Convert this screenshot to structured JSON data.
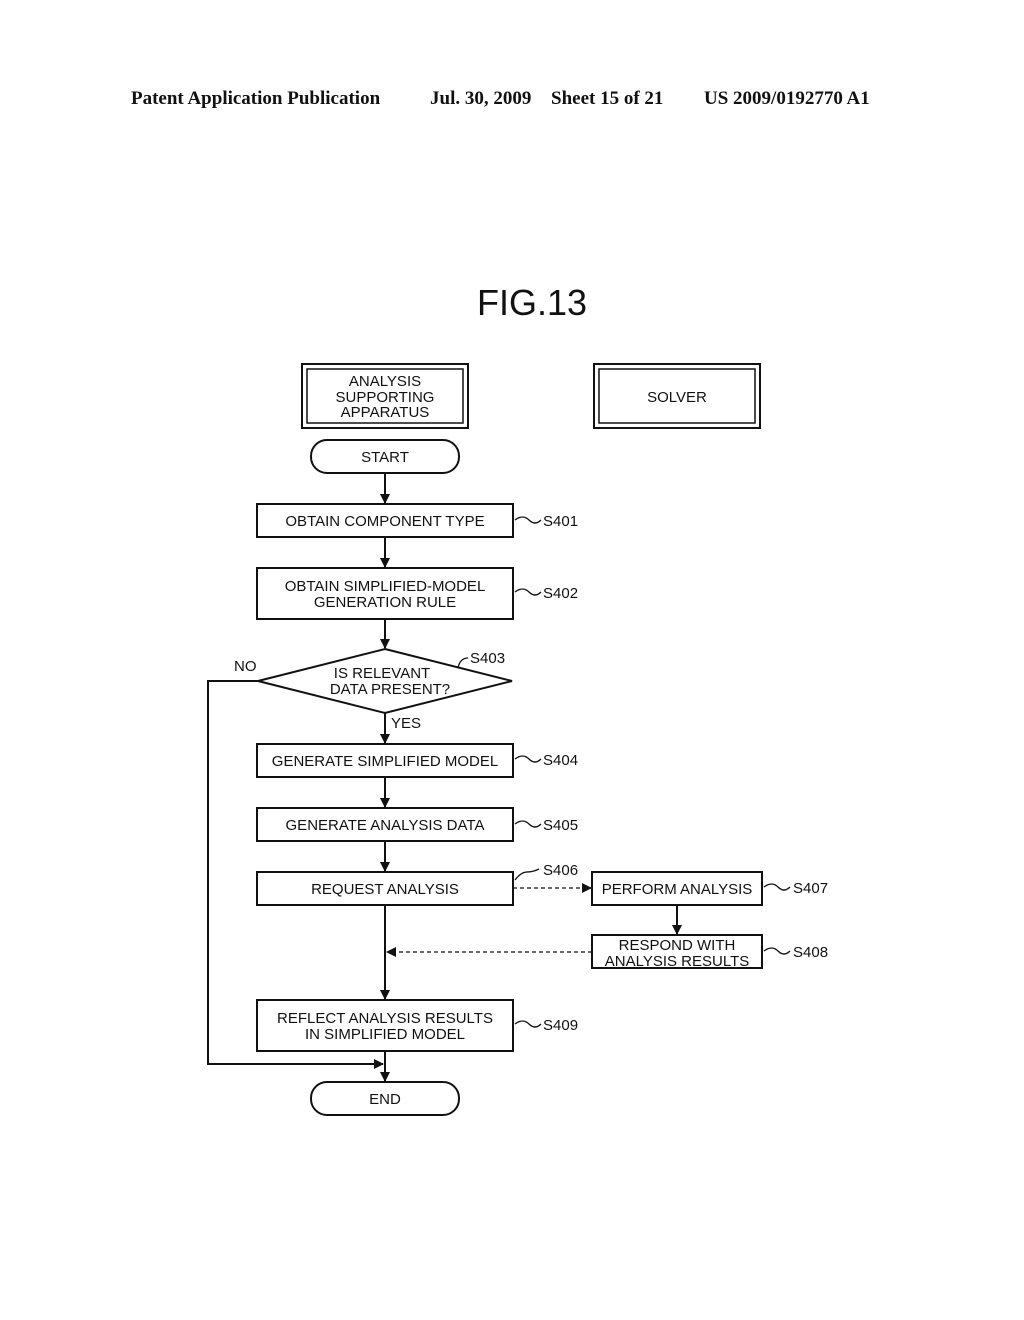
{
  "header": {
    "publication": "Patent Application Publication",
    "date": "Jul. 30, 2009",
    "sheet": "Sheet 15 of 21",
    "number": "US 2009/0192770 A1"
  },
  "figure": {
    "title": "FIG.13"
  },
  "lanes": {
    "left": [
      "ANALYSIS",
      "SUPPORTING",
      "APPARATUS"
    ],
    "right": [
      "SOLVER"
    ]
  },
  "terminals": {
    "start": "START",
    "end": "END"
  },
  "steps": {
    "s401": {
      "id": "S401",
      "lines": [
        "OBTAIN COMPONENT TYPE"
      ]
    },
    "s402": {
      "id": "S402",
      "lines": [
        "OBTAIN SIMPLIFIED-MODEL",
        "GENERATION RULE"
      ]
    },
    "s403": {
      "id": "S403",
      "lines": [
        "IS RELEVANT",
        "DATA PRESENT?"
      ]
    },
    "s404": {
      "id": "S404",
      "lines": [
        "GENERATE SIMPLIFIED MODEL"
      ]
    },
    "s405": {
      "id": "S405",
      "lines": [
        "GENERATE ANALYSIS DATA"
      ]
    },
    "s406": {
      "id": "S406",
      "lines": [
        "REQUEST ANALYSIS"
      ]
    },
    "s407": {
      "id": "S407",
      "lines": [
        "PERFORM ANALYSIS"
      ]
    },
    "s408": {
      "id": "S408",
      "lines": [
        "RESPOND WITH",
        "ANALYSIS RESULTS"
      ]
    },
    "s409": {
      "id": "S409",
      "lines": [
        "REFLECT ANALYSIS RESULTS",
        "IN SIMPLIFIED MODEL"
      ]
    }
  },
  "branches": {
    "yes": "YES",
    "no": "NO"
  }
}
